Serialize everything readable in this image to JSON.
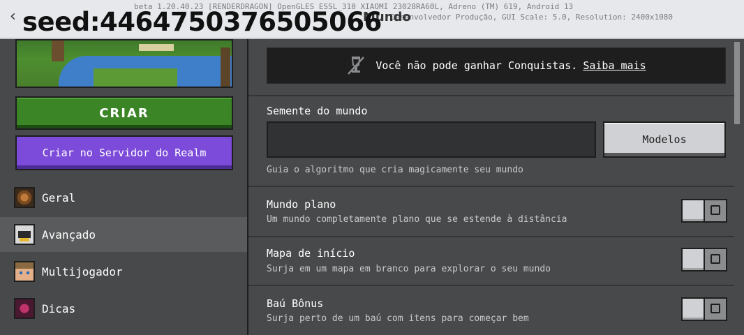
{
  "topbar": {
    "debug_line_1": "beta 1.20.40.23 [RENDERDRAGON] OpenGLES ESSL_310 XIAOMI 23028RA60L, Adreno (TM) 619, Android 13",
    "debug_line_2": "Desenvolvedor Produção, GUI Scale: 5.0, Resolution: 2400x1080",
    "title": "Mundo",
    "seed_overlay": "seed:4464750376505066"
  },
  "sidebar": {
    "create_label": "CRIAR",
    "realm_label": "Criar no Servidor do Realm",
    "items": [
      {
        "label": "Geral",
        "icon": "gear-block-icon"
      },
      {
        "label": "Avançado",
        "icon": "advanced-chest-icon"
      },
      {
        "label": "Multijogador",
        "icon": "player-face-icon"
      },
      {
        "label": "Dicas",
        "icon": "tips-block-icon"
      }
    ],
    "active_index": 1
  },
  "content": {
    "achievements_notice": "Você não pode ganhar Conquistas.",
    "achievements_link": "Saiba mais",
    "seed_label": "Semente do mundo",
    "seed_value": "",
    "seed_placeholder": "",
    "models_label": "Modelos",
    "seed_hint": "Guia o algoritmo que cria magicamente seu mundo",
    "options": [
      {
        "title": "Mundo plano",
        "desc": "Um mundo completamente plano que se estende à distância",
        "enabled": false
      },
      {
        "title": "Mapa de início",
        "desc": "Surja em um mapa em branco para explorar o seu mundo",
        "enabled": false
      },
      {
        "title": "Baú Bônus",
        "desc": "Surja perto de um baú com itens para começar bem",
        "enabled": false
      }
    ]
  },
  "colors": {
    "create_green": "#3c8527",
    "realm_purple": "#7c4bd9",
    "panel_bg": "#48494a",
    "notice_bg": "#1e1e1f"
  }
}
